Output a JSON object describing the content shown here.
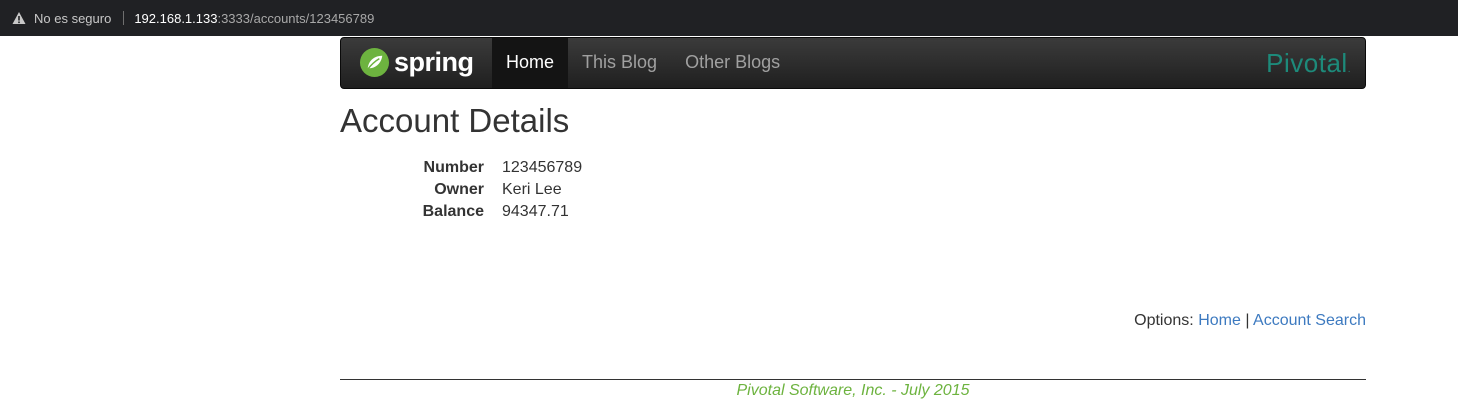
{
  "browser": {
    "security_label": "No es seguro",
    "url_host": "192.168.1.133",
    "url_rest": ":3333/accounts/123456789"
  },
  "navbar": {
    "brand": "spring",
    "items": [
      {
        "label": "Home",
        "active": true
      },
      {
        "label": "This Blog",
        "active": false
      },
      {
        "label": "Other Blogs",
        "active": false
      }
    ],
    "right_logo": "Pivotal",
    "right_logo_mark": "."
  },
  "page": {
    "title": "Account Details",
    "details": [
      {
        "label": "Number",
        "value": "123456789"
      },
      {
        "label": "Owner",
        "value": "Keri Lee"
      },
      {
        "label": "Balance",
        "value": "94347.71"
      }
    ],
    "options_label": "Options:",
    "options_links": [
      "Home",
      "Account Search"
    ],
    "options_separator": "|",
    "footer": "Pivotal Software, Inc. - July 2015"
  },
  "colors": {
    "accent_green": "#6db33f",
    "pivotal_teal": "#1d8a7a",
    "link_blue": "#3d7ac0"
  }
}
